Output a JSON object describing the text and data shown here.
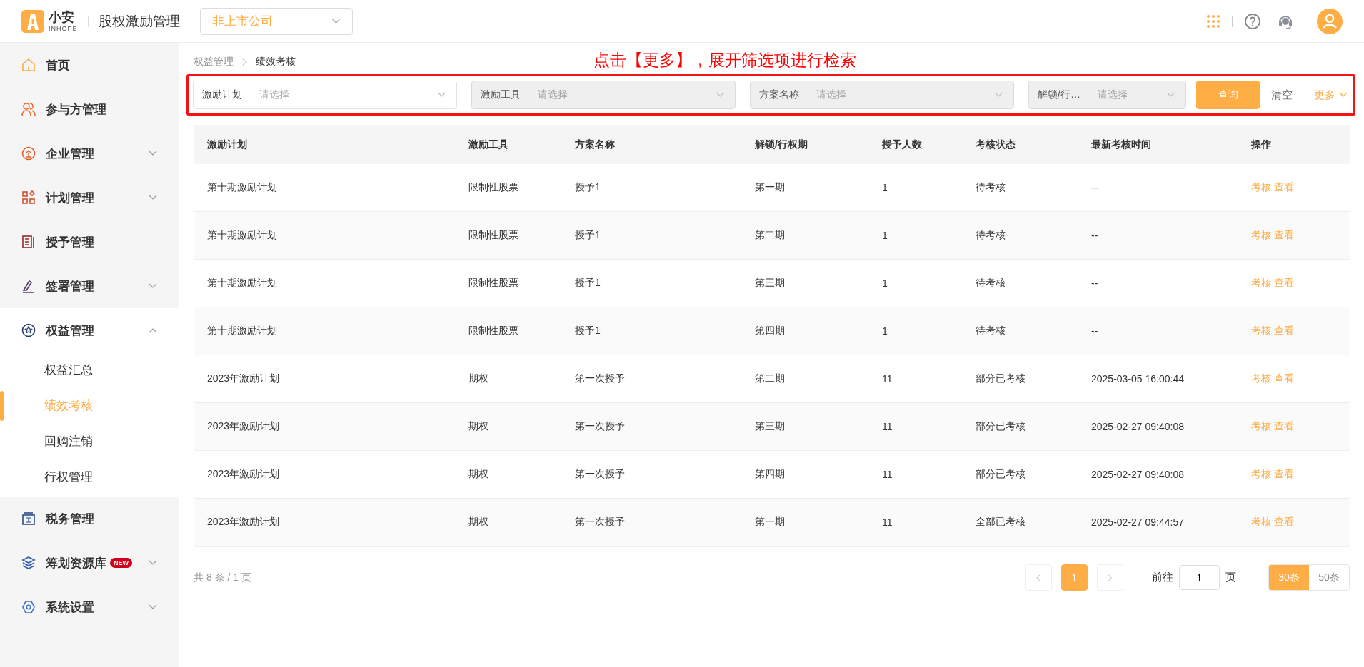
{
  "header": {
    "logo": {
      "name": "小安",
      "sub": "INHOPE"
    },
    "app_title": "股权激励管理",
    "company_select": {
      "value": "非上市公司"
    }
  },
  "sidebar": {
    "items": [
      {
        "label": "首页",
        "has_submenu": false
      },
      {
        "label": "参与方管理",
        "has_submenu": false
      },
      {
        "label": "企业管理",
        "has_submenu": true,
        "expanded": false
      },
      {
        "label": "计划管理",
        "has_submenu": true,
        "expanded": false
      },
      {
        "label": "授予管理",
        "has_submenu": false
      },
      {
        "label": "签署管理",
        "has_submenu": true,
        "expanded": false
      },
      {
        "label": "权益管理",
        "has_submenu": true,
        "expanded": true,
        "children": [
          {
            "label": "权益汇总",
            "selected": false
          },
          {
            "label": "绩效考核",
            "selected": true
          },
          {
            "label": "回购注销",
            "selected": false
          },
          {
            "label": "行权管理",
            "selected": false
          }
        ]
      },
      {
        "label": "税务管理",
        "has_submenu": false
      },
      {
        "label": "筹划资源库",
        "badge": "NEW",
        "has_submenu": true,
        "expanded": false
      },
      {
        "label": "系统设置",
        "has_submenu": true,
        "expanded": false
      }
    ]
  },
  "breadcrumb": [
    "权益管理",
    "绩效考核"
  ],
  "annotation": "点击【更多】，展开筛选项进行检索",
  "filters": [
    {
      "label": "激励计划",
      "placeholder": "请选择",
      "disabled": false
    },
    {
      "label": "激励工具",
      "placeholder": "请选择",
      "disabled": true
    },
    {
      "label": "方案名称",
      "placeholder": "请选择",
      "disabled": true
    },
    {
      "label": "解锁/行…",
      "placeholder": "请选择",
      "disabled": true
    }
  ],
  "filter_actions": {
    "query": "查询",
    "clear": "清空",
    "more": "更多"
  },
  "table": {
    "columns": [
      "激励计划",
      "激励工具",
      "方案名称",
      "解锁/行权期",
      "授予人数",
      "考核状态",
      "最新考核时间",
      "操作"
    ],
    "rows": [
      {
        "cells": [
          "第十期激励计划",
          "限制性股票",
          "授予1",
          "第一期",
          "1",
          "待考核",
          "--"
        ],
        "actions": [
          "考核",
          "查看"
        ]
      },
      {
        "cells": [
          "第十期激励计划",
          "限制性股票",
          "授予1",
          "第二期",
          "1",
          "待考核",
          "--"
        ],
        "actions": [
          "考核",
          "查看"
        ]
      },
      {
        "cells": [
          "第十期激励计划",
          "限制性股票",
          "授予1",
          "第三期",
          "1",
          "待考核",
          "--"
        ],
        "actions": [
          "考核",
          "查看"
        ]
      },
      {
        "cells": [
          "第十期激励计划",
          "限制性股票",
          "授予1",
          "第四期",
          "1",
          "待考核",
          "--"
        ],
        "actions": [
          "考核",
          "查看"
        ]
      },
      {
        "cells": [
          "2023年激励计划",
          "期权",
          "第一次授予",
          "第二期",
          "11",
          "部分已考核",
          "2025-03-05 16:00:44"
        ],
        "actions": [
          "考核",
          "查看"
        ]
      },
      {
        "cells": [
          "2023年激励计划",
          "期权",
          "第一次授予",
          "第三期",
          "11",
          "部分已考核",
          "2025-02-27 09:40:08"
        ],
        "actions": [
          "考核",
          "查看"
        ]
      },
      {
        "cells": [
          "2023年激励计划",
          "期权",
          "第一次授予",
          "第四期",
          "11",
          "部分已考核",
          "2025-02-27 09:40:08"
        ],
        "actions": [
          "考核",
          "查看"
        ]
      },
      {
        "cells": [
          "2023年激励计划",
          "期权",
          "第一次授予",
          "第一期",
          "11",
          "全部已考核",
          "2025-02-27 09:44:57"
        ],
        "actions": [
          "考核",
          "查看"
        ]
      }
    ]
  },
  "pagination": {
    "summary": "共 8 条 / 1 页",
    "pages": [
      {
        "label": "1",
        "selected": true
      }
    ],
    "goto_label": "前往",
    "goto_value": "1",
    "goto_unit": "页",
    "sizes": [
      {
        "label": "30条",
        "selected": true
      },
      {
        "label": "50条",
        "selected": false
      }
    ]
  }
}
